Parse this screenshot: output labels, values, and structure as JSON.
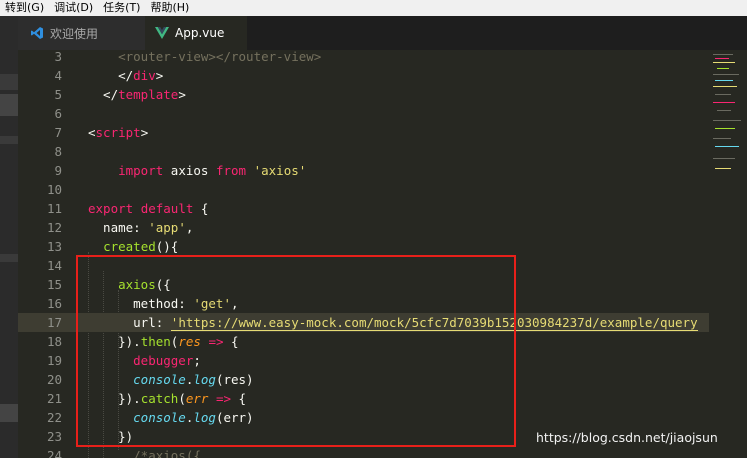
{
  "menu": [
    "转到(G)",
    "调试(D)",
    "任务(T)",
    "帮助(H)"
  ],
  "tabs": [
    {
      "label": "欢迎使用",
      "icon": "vscode-icon",
      "active": false
    },
    {
      "label": "App.vue",
      "icon": "vue-icon",
      "active": true
    }
  ],
  "editor": {
    "lines": [
      {
        "n": "3",
        "tokens": [
          [
            "    <router-view></router-view>",
            "ghost"
          ]
        ]
      },
      {
        "n": "4",
        "tokens": [
          [
            "    </",
            ""
          ],
          [
            "div",
            "k"
          ],
          [
            ">",
            ""
          ]
        ]
      },
      {
        "n": "5",
        "tokens": [
          [
            "  </",
            ""
          ],
          [
            "template",
            "k"
          ],
          [
            ">",
            ""
          ]
        ]
      },
      {
        "n": "6",
        "tokens": []
      },
      {
        "n": "7",
        "tokens": [
          [
            "<",
            ""
          ],
          [
            "script",
            "k"
          ],
          [
            ">",
            ""
          ]
        ]
      },
      {
        "n": "8",
        "tokens": []
      },
      {
        "n": "9",
        "tokens": [
          [
            "    ",
            ""
          ],
          [
            "import",
            "k"
          ],
          [
            " axios ",
            ""
          ],
          [
            "from",
            "k"
          ],
          [
            " ",
            ""
          ],
          [
            "'axios'",
            "s"
          ]
        ]
      },
      {
        "n": "10",
        "tokens": []
      },
      {
        "n": "11",
        "tokens": [
          [
            "export",
            "k"
          ],
          [
            " ",
            ""
          ],
          [
            "default",
            "k"
          ],
          [
            " {",
            ""
          ]
        ]
      },
      {
        "n": "12",
        "tokens": [
          [
            "  name: ",
            ""
          ],
          [
            "'app'",
            "s"
          ],
          [
            ",",
            ""
          ]
        ]
      },
      {
        "n": "13",
        "tokens": [
          [
            "  ",
            ""
          ],
          [
            "created",
            "f"
          ],
          [
            "(){",
            ""
          ]
        ]
      },
      {
        "n": "14",
        "tokens": []
      },
      {
        "n": "15",
        "tokens": [
          [
            "    ",
            ""
          ],
          [
            "axios",
            "f"
          ],
          [
            "({",
            ""
          ]
        ]
      },
      {
        "n": "16",
        "tokens": [
          [
            "      method: ",
            ""
          ],
          [
            "'get'",
            "s"
          ],
          [
            ",",
            ""
          ]
        ]
      },
      {
        "n": "17",
        "hl": true,
        "tokens": [
          [
            "      url: ",
            ""
          ],
          [
            "'https://www.easy-mock.com/mock/5cfc7d7039b152030984237d/example/query",
            "s u"
          ]
        ]
      },
      {
        "n": "18",
        "tokens": [
          [
            "    }).",
            ""
          ],
          [
            "then",
            "f"
          ],
          [
            "(",
            ""
          ],
          [
            "res",
            "p"
          ],
          [
            " ",
            ""
          ],
          [
            "=>",
            "k"
          ],
          [
            " {",
            ""
          ]
        ]
      },
      {
        "n": "19",
        "tokens": [
          [
            "      ",
            ""
          ],
          [
            "debugger",
            "k"
          ],
          [
            ";",
            ""
          ]
        ]
      },
      {
        "n": "20",
        "tokens": [
          [
            "      ",
            ""
          ],
          [
            "console",
            "c"
          ],
          [
            ".",
            ""
          ],
          [
            "log",
            "c"
          ],
          [
            "(res)",
            ""
          ]
        ]
      },
      {
        "n": "21",
        "tokens": [
          [
            "    }).",
            ""
          ],
          [
            "catch",
            "f"
          ],
          [
            "(",
            ""
          ],
          [
            "err",
            "p"
          ],
          [
            " ",
            ""
          ],
          [
            "=>",
            "k"
          ],
          [
            " {",
            ""
          ]
        ]
      },
      {
        "n": "22",
        "tokens": [
          [
            "      ",
            ""
          ],
          [
            "console",
            "c"
          ],
          [
            ".",
            ""
          ],
          [
            "log",
            "c"
          ],
          [
            "(err)",
            ""
          ]
        ]
      },
      {
        "n": "23",
        "tokens": [
          [
            "    })",
            ""
          ]
        ]
      },
      {
        "n": "24",
        "tokens": [
          [
            "      /*axios({",
            "cm"
          ]
        ]
      }
    ]
  },
  "watermark": "https://blog.csdn.net/jiaojsun",
  "colors": {
    "highlight_box": "#e8201a",
    "keyword": "#f92672",
    "string": "#e6db74",
    "function": "#a6e22e",
    "builtin": "#66d9ef",
    "param": "#fd971f"
  }
}
